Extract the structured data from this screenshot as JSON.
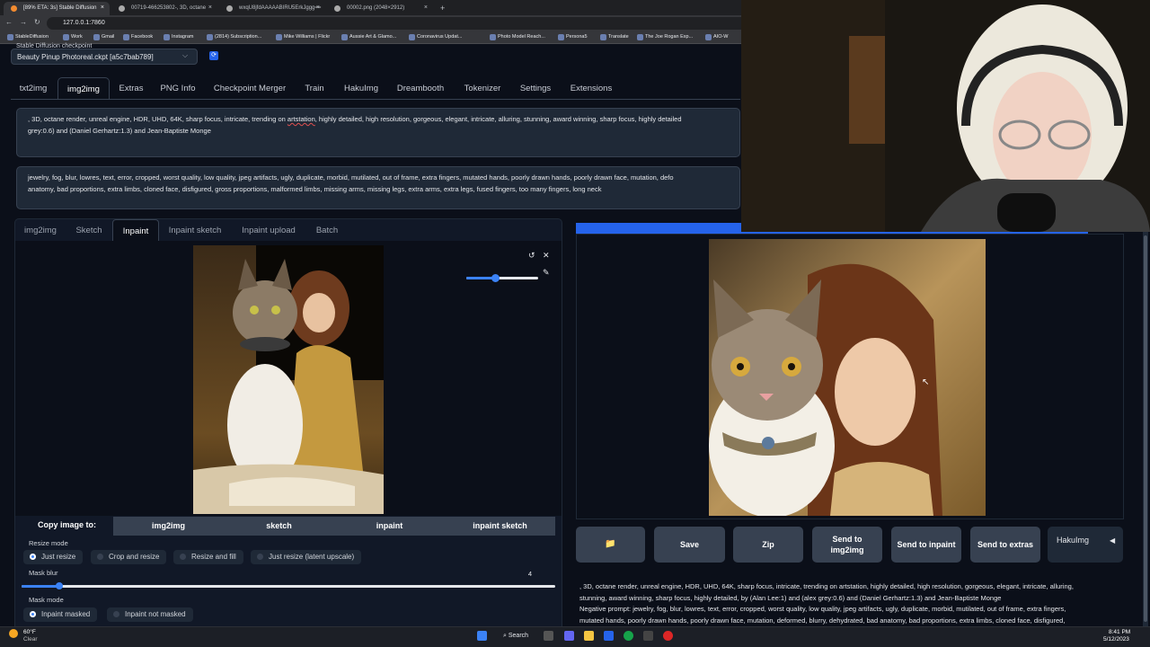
{
  "browser": {
    "tabs": [
      {
        "title": "[89% ETA: 3s] Stable Diffusion",
        "active": true
      },
      {
        "title": "00719-466253802-, 3D, octane",
        "active": false
      },
      {
        "title": "wxqU8jfdAAAAABIRU5ErkJggg==",
        "active": false
      },
      {
        "title": "00002.png (2048×2912)",
        "active": false
      }
    ],
    "new_tab": "+",
    "close_glyph": "×",
    "url": "127.0.0.1:7860",
    "bookmarks": [
      "StableDiffusion",
      "Work",
      "Gmail",
      "Facebook",
      "Instagram",
      "(2814) Subscription...",
      "Mike Williams | Flickr",
      "Aussie Art & Glamo...",
      "Coronavirus Updat...",
      "Photo Model Reach...",
      "Persona5",
      "Translate",
      "The Joe Rogan Exp...",
      "AIO-W"
    ]
  },
  "checkpoint": {
    "label": "Stable Diffusion checkpoint",
    "value": "Beauty Pinup Photoreal.ckpt [a5c7bab789]",
    "chevron": "⌵",
    "refresh": "⟳"
  },
  "main_tabs": [
    "txt2img",
    "img2img",
    "Extras",
    "PNG Info",
    "Checkpoint Merger",
    "Train",
    "HakuImg",
    "Dreambooth",
    "Tokenizer",
    "Settings",
    "Extensions"
  ],
  "prompt": {
    "line1_a": ", 3D, octane render, unreal engine, HDR, UHD, 64K, sharp focus, intricate, trending on ",
    "line1_b": "artstation",
    "line1_c": ", highly detailed, high resolution, gorgeous, elegant, intricate, alluring, stunning, award winning, sharp focus, highly detailed",
    "line2": "grey:0.6) and (Daniel Gerhartz:1.3) and Jean-Baptiste Monge"
  },
  "negative_prompt": {
    "line1": "jewelry, fog, blur, lowres, text, error, cropped, worst quality, low quality, jpeg artifacts, ugly, duplicate, morbid, mutilated, out of frame, extra fingers, mutated hands, poorly drawn hands, poorly drawn face, mutation, defo",
    "line2": "anatomy, bad proportions, extra limbs, cloned face, disfigured, gross proportions, malformed limbs, missing arms, missing legs, extra arms, extra legs, fused fingers, too many fingers, long neck"
  },
  "sub_tabs": [
    "img2img",
    "Sketch",
    "Inpaint",
    "Inpaint sketch",
    "Inpaint upload",
    "Batch"
  ],
  "canvas_tools": {
    "undo": "↺",
    "clear": "✕",
    "brush": "✎",
    "brush_size": 0.4
  },
  "copy_image_to": {
    "label": "Copy image to:",
    "targets": [
      "img2img",
      "sketch",
      "inpaint",
      "inpaint sketch"
    ]
  },
  "resize_mode": {
    "label": "Resize mode",
    "options": [
      "Just resize",
      "Crop and resize",
      "Resize and fill",
      "Just resize (latent upscale)"
    ],
    "selected": "Just resize"
  },
  "mask_blur": {
    "label": "Mask blur",
    "value": "4",
    "level": 0.07
  },
  "mask_mode": {
    "label": "Mask mode",
    "options": [
      "Inpaint masked",
      "Inpaint not masked"
    ],
    "selected": "Inpaint masked"
  },
  "progress": {
    "fraction": 0.89
  },
  "actions": {
    "folder": "📁",
    "save": "Save",
    "zip": "Zip",
    "send_img2img": "Send to img2img",
    "send_inpaint": "Send to inpaint",
    "send_extras": "Send to extras",
    "haku": "HakuImg",
    "haku_arrow": "◀"
  },
  "info": {
    "line1": ", 3D, octane render, unreal engine, HDR, UHD, 64K, sharp focus, intricate, trending on artstation, highly detailed, high resolution, gorgeous, elegant, intricate, alluring,",
    "line2": "stunning, award winning, sharp focus, highly detailed, by (Alan Lee:1) and (alex grey:0.6) and (Daniel Gerhartz:1.3) and Jean-Baptiste Monge",
    "line3": "Negative prompt: jewelry, fog, blur, lowres, text, error, cropped, worst quality, low quality, jpeg artifacts, ugly, duplicate, morbid, mutilated, out of frame, extra fingers,",
    "line4": "mutated hands, poorly drawn hands, poorly drawn face, mutation, deformed, blurry, dehydrated, bad anatomy, bad proportions, extra limbs, cloned face, disfigured,"
  },
  "taskbar": {
    "temp": "60°F",
    "weather": "Clear",
    "search": "Search",
    "time": "8:41 PM",
    "date": "5/12/2023"
  },
  "colors": {
    "accent": "#2563eb",
    "bg": "#0b0f19",
    "panel": "#1f2937",
    "button": "#374151"
  }
}
